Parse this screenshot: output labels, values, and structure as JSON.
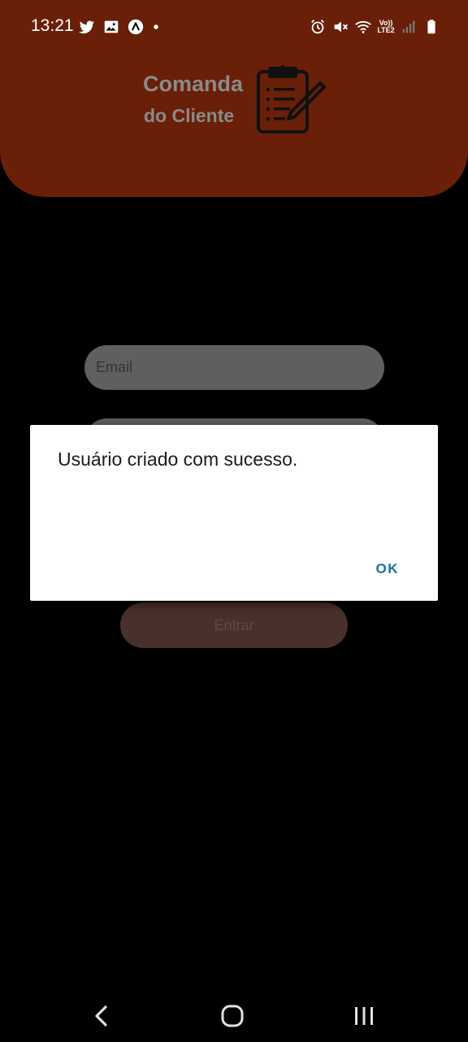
{
  "status_bar": {
    "time": "13:21",
    "left_icons": [
      "twitter-icon",
      "image-icon",
      "app-icon",
      "dot-icon"
    ],
    "right_icons": [
      "alarm-icon",
      "mute-icon",
      "wifi-icon",
      "lte-icon",
      "signal-icon",
      "battery-icon"
    ],
    "lte_top": "Vo))",
    "lte_bottom": "LTE2"
  },
  "header": {
    "title": "Comanda",
    "subtitle": "do Cliente",
    "logo_icon": "clipboard-pen-icon",
    "background": "#6a1f08"
  },
  "form": {
    "email_placeholder": "Email",
    "password_placeholder": "",
    "enter_label": "Entrar"
  },
  "dialog": {
    "message": "Usuário criado com sucesso.",
    "ok_label": "OK",
    "accent": "#1a6fa8"
  },
  "nav_bar": {
    "back": "back-icon",
    "home": "home-icon",
    "recents": "recents-icon"
  }
}
